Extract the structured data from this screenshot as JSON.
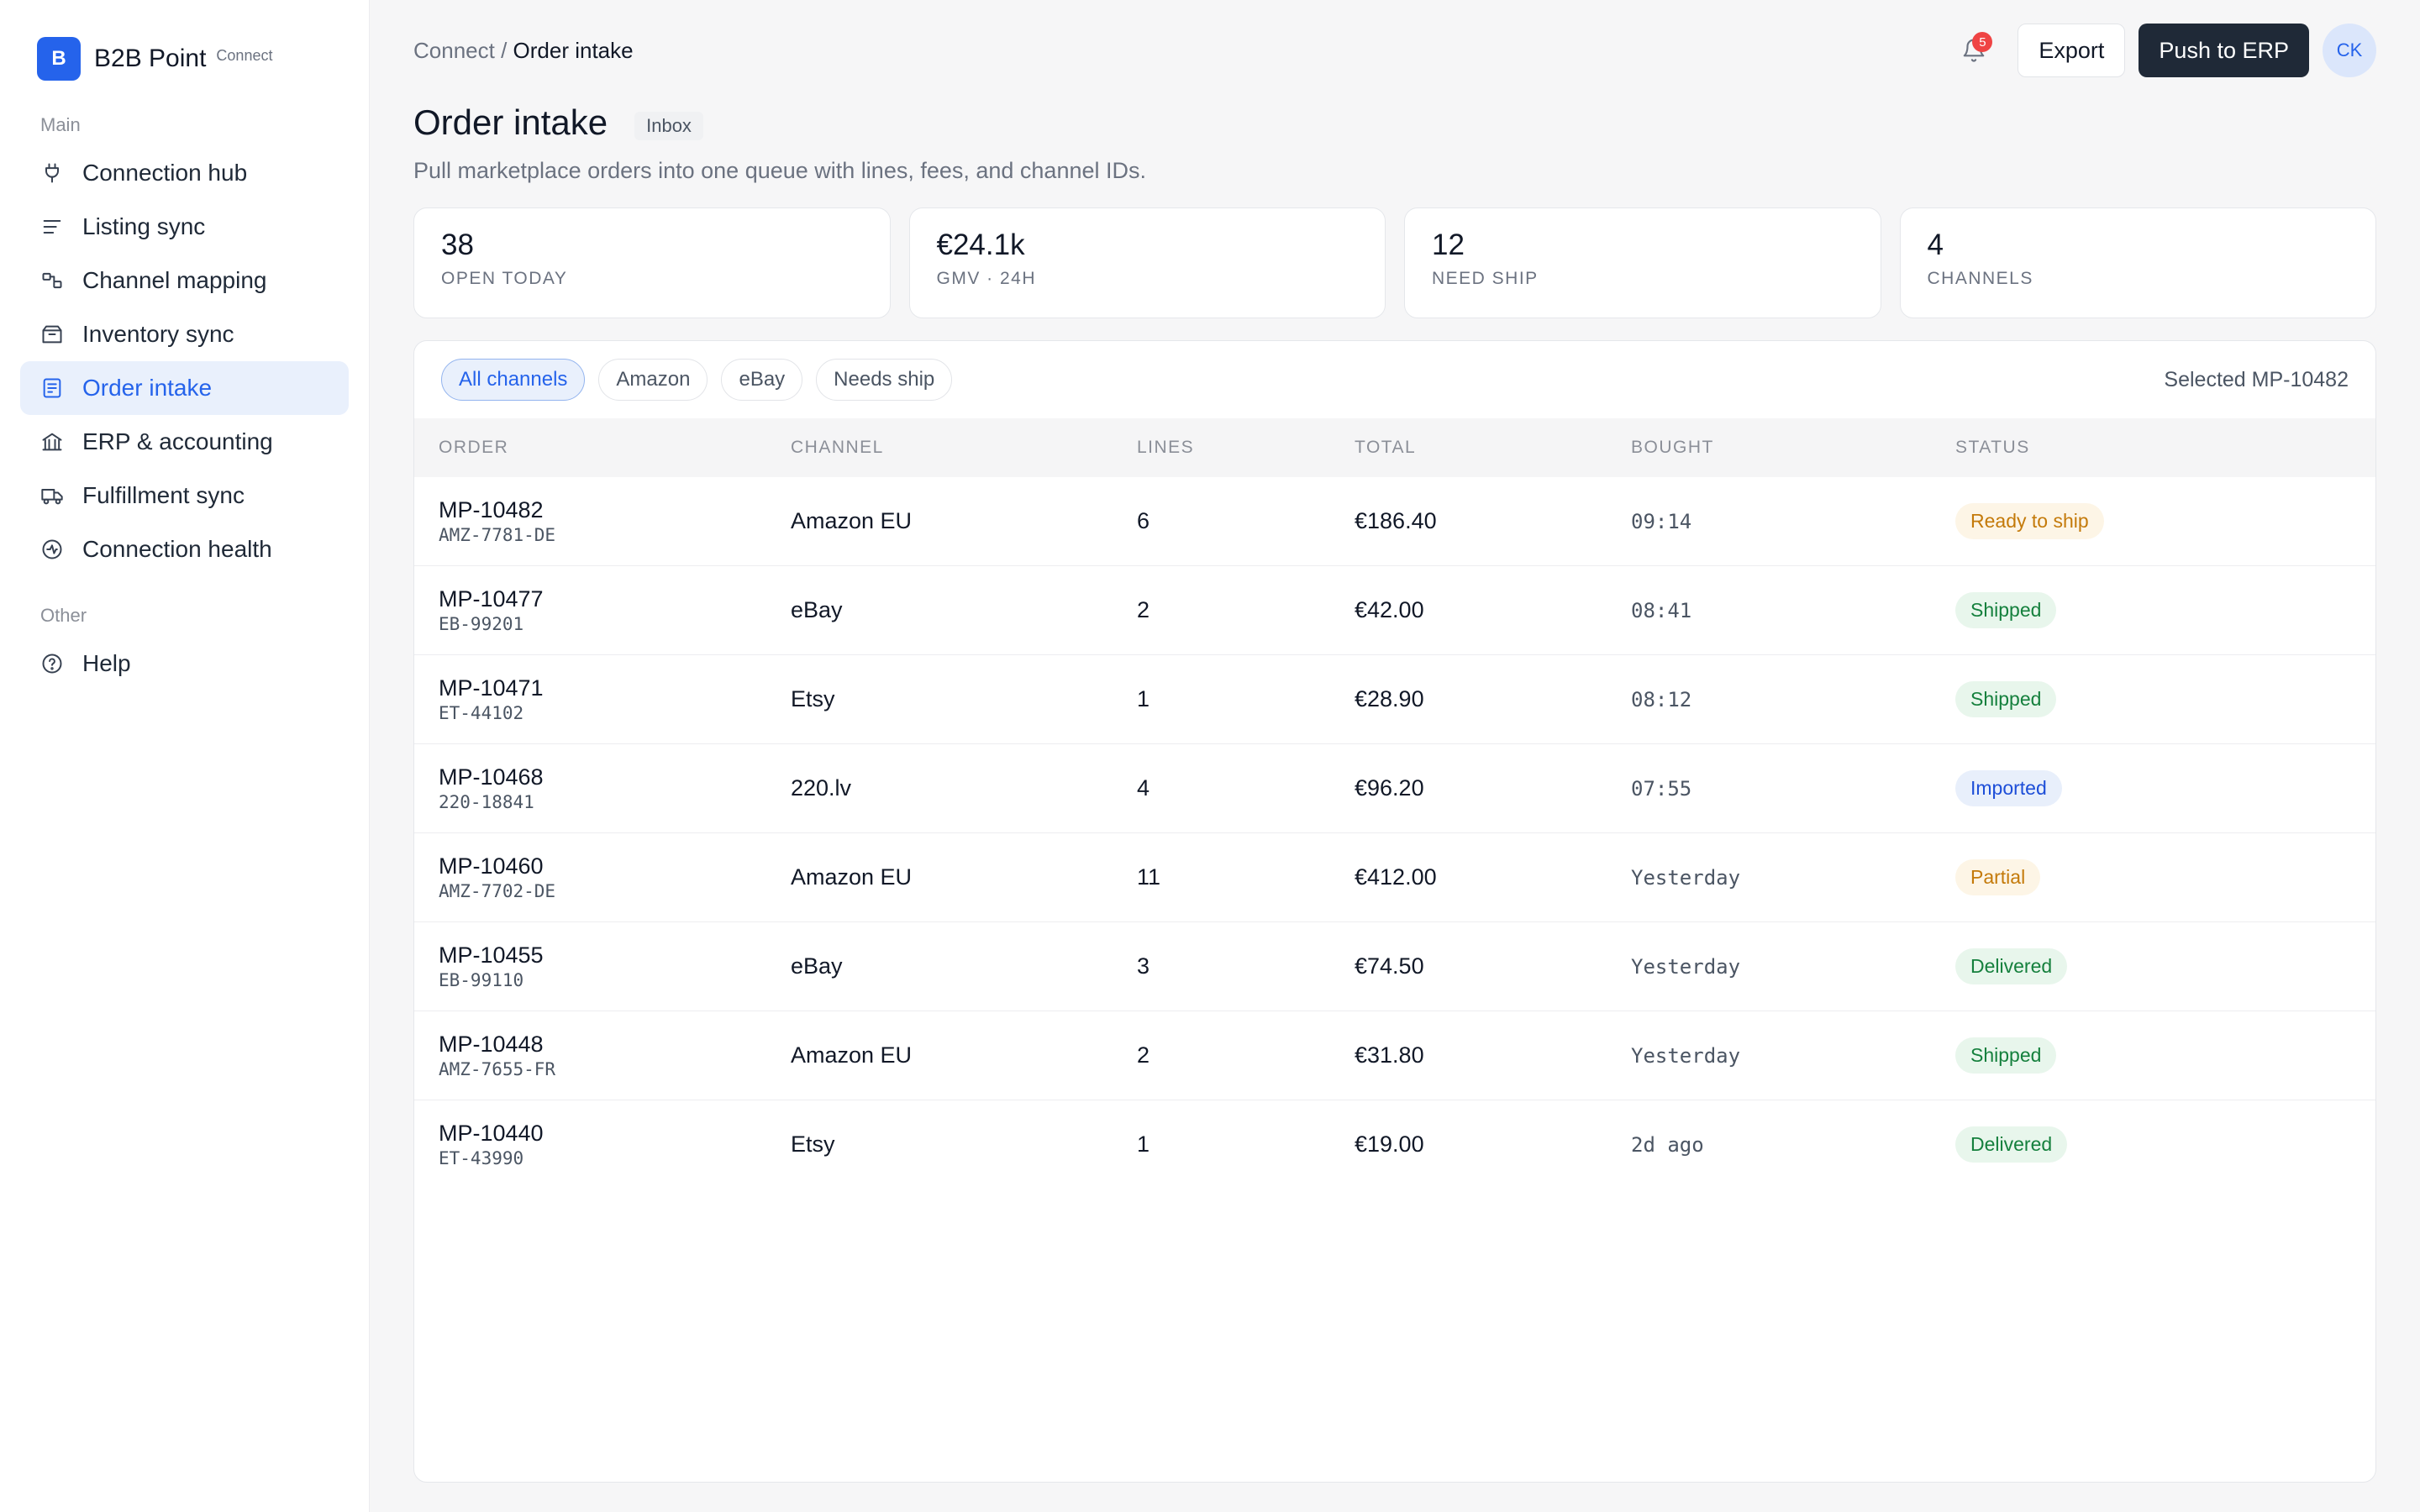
{
  "brand": {
    "logo_letter": "B",
    "name": "B2B Point",
    "sub": "Connect"
  },
  "sidebar": {
    "main_label": "Main",
    "items": [
      {
        "label": "Connection hub",
        "icon": "plug-icon"
      },
      {
        "label": "Listing sync",
        "icon": "list-icon"
      },
      {
        "label": "Channel mapping",
        "icon": "mapping-icon"
      },
      {
        "label": "Inventory sync",
        "icon": "box-icon"
      },
      {
        "label": "Order intake",
        "icon": "order-icon",
        "active": true
      },
      {
        "label": "ERP & accounting",
        "icon": "bank-icon"
      },
      {
        "label": "Fulfillment sync",
        "icon": "truck-icon"
      },
      {
        "label": "Connection health",
        "icon": "pulse-icon"
      }
    ],
    "other_label": "Other",
    "other_items": [
      {
        "label": "Help",
        "icon": "help-icon"
      }
    ]
  },
  "header": {
    "breadcrumb_parent": "Connect /",
    "breadcrumb_current": "Order intake",
    "notification_count": "5",
    "export_label": "Export",
    "push_label": "Push to ERP",
    "avatar_initials": "CK"
  },
  "page": {
    "title": "Order intake",
    "tag": "Inbox",
    "subtitle": "Pull marketplace orders into one queue with lines, fees, and channel IDs."
  },
  "stats": [
    {
      "value": "38",
      "label": "OPEN TODAY"
    },
    {
      "value": "€24.1k",
      "label": "GMV · 24H"
    },
    {
      "value": "12",
      "label": "NEED SHIP"
    },
    {
      "value": "4",
      "label": "CHANNELS"
    }
  ],
  "filters": {
    "chips": [
      "All channels",
      "Amazon",
      "eBay",
      "Needs ship"
    ],
    "active_index": 0,
    "selected_text": "Selected MP-10482"
  },
  "table": {
    "columns": [
      "ORDER",
      "CHANNEL",
      "LINES",
      "TOTAL",
      "BOUGHT",
      "STATUS"
    ],
    "rows": [
      {
        "order": "MP-10482",
        "ref": "AMZ-7781-DE",
        "channel": "Amazon EU",
        "lines": "6",
        "total": "€186.40",
        "bought": "09:14",
        "status": "Ready to ship",
        "status_kind": "ready"
      },
      {
        "order": "MP-10477",
        "ref": "EB-99201",
        "channel": "eBay",
        "lines": "2",
        "total": "€42.00",
        "bought": "08:41",
        "status": "Shipped",
        "status_kind": "shipped"
      },
      {
        "order": "MP-10471",
        "ref": "ET-44102",
        "channel": "Etsy",
        "lines": "1",
        "total": "€28.90",
        "bought": "08:12",
        "status": "Shipped",
        "status_kind": "shipped"
      },
      {
        "order": "MP-10468",
        "ref": "220-18841",
        "channel": "220.lv",
        "lines": "4",
        "total": "€96.20",
        "bought": "07:55",
        "status": "Imported",
        "status_kind": "imported"
      },
      {
        "order": "MP-10460",
        "ref": "AMZ-7702-DE",
        "channel": "Amazon EU",
        "lines": "11",
        "total": "€412.00",
        "bought": "Yesterday",
        "status": "Partial",
        "status_kind": "partial"
      },
      {
        "order": "MP-10455",
        "ref": "EB-99110",
        "channel": "eBay",
        "lines": "3",
        "total": "€74.50",
        "bought": "Yesterday",
        "status": "Delivered",
        "status_kind": "delivered"
      },
      {
        "order": "MP-10448",
        "ref": "AMZ-7655-FR",
        "channel": "Amazon EU",
        "lines": "2",
        "total": "€31.80",
        "bought": "Yesterday",
        "status": "Shipped",
        "status_kind": "shipped"
      },
      {
        "order": "MP-10440",
        "ref": "ET-43990",
        "channel": "Etsy",
        "lines": "1",
        "total": "€19.00",
        "bought": "2d ago",
        "status": "Delivered",
        "status_kind": "delivered"
      }
    ]
  }
}
